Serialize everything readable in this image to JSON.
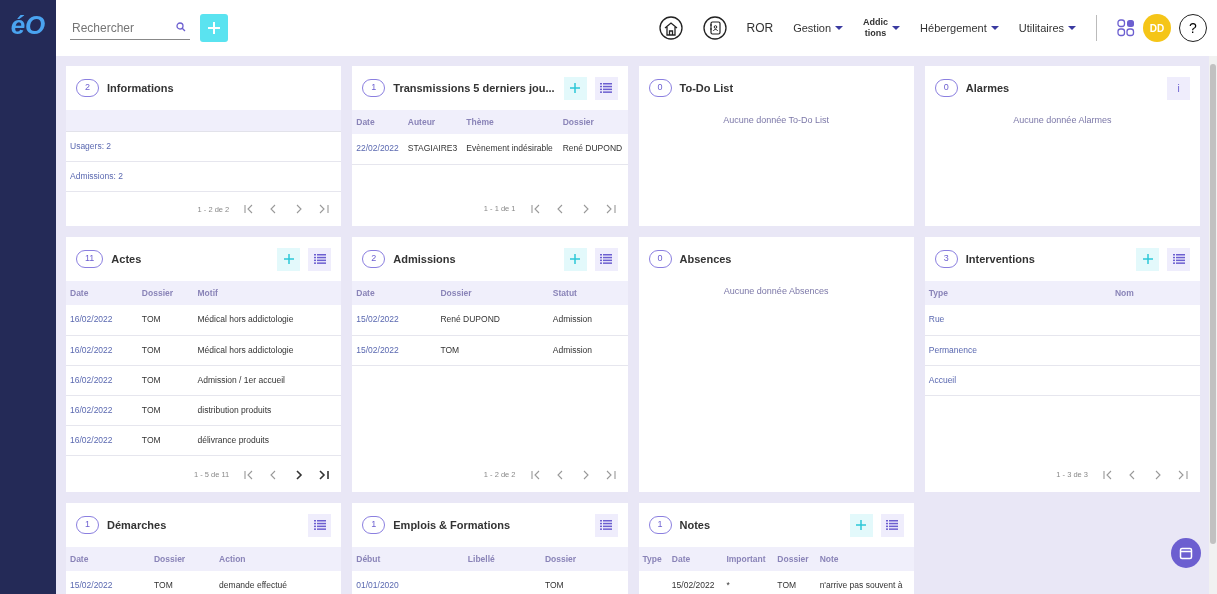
{
  "logo": {
    "text": "éO"
  },
  "search": {
    "placeholder": "Rechercher"
  },
  "topnav": [
    {
      "kind": "home"
    },
    {
      "kind": "contacts"
    },
    {
      "kind": "link",
      "label": "ROR"
    },
    {
      "kind": "dropdown",
      "label": "Gestion"
    },
    {
      "kind": "stacked",
      "lines": [
        "Addic",
        "tions"
      ]
    },
    {
      "kind": "dropdown",
      "label": "Hébergement"
    },
    {
      "kind": "dropdown",
      "label": "Utilitaires"
    }
  ],
  "user": {
    "initials": "DD",
    "help": "?"
  },
  "cards": [
    {
      "title": "Informations",
      "count": "2",
      "rows": [
        [
          "Usagers: 2"
        ],
        [
          "Admissions: 2"
        ]
      ],
      "pager": {
        "range": "1 - 2 de 2",
        "has_next": false
      }
    },
    {
      "title": "Transmissions 5 derniers jou...",
      "count": "1",
      "actions": [
        {
          "kind": "add"
        },
        {
          "kind": "list"
        }
      ],
      "columns": [
        "Date",
        "Auteur",
        "Thème",
        "Dossier"
      ],
      "rows": [
        [
          "22/02/2022",
          "STAGIAIRE3",
          "Evènement indésirable",
          "René DUPOND"
        ]
      ],
      "pager": {
        "range": "1 - 1 de 1",
        "has_next": false
      }
    },
    {
      "title": "To-Do List",
      "count": "0",
      "empty_text": "Aucune donnée To-Do List"
    },
    {
      "title": "Alarmes",
      "count": "0",
      "actions": [
        {
          "kind": "info",
          "label": "i"
        }
      ],
      "empty_text": "Aucune donnée Alarmes"
    },
    {
      "title": "Actes",
      "count": "11",
      "actions": [
        {
          "kind": "add"
        },
        {
          "kind": "list"
        }
      ],
      "columns": [
        "Date",
        "Dossier",
        "Motif"
      ],
      "rows": [
        [
          "16/02/2022",
          "TOM",
          "Médical hors addictologie"
        ],
        [
          "16/02/2022",
          "TOM",
          "Médical hors addictologie"
        ],
        [
          "16/02/2022",
          "TOM",
          "Admission / 1er accueil"
        ],
        [
          "16/02/2022",
          "TOM",
          "distribution produits"
        ],
        [
          "16/02/2022",
          "TOM",
          "délivrance produits"
        ]
      ],
      "pager": {
        "range": "1 - 5 de 11",
        "has_next": true
      }
    },
    {
      "title": "Admissions",
      "count": "2",
      "actions": [
        {
          "kind": "add"
        },
        {
          "kind": "list"
        }
      ],
      "columns": [
        "Date",
        "Dossier",
        "Statut"
      ],
      "rows": [
        [
          "15/02/2022",
          "René DUPOND",
          "Admission"
        ],
        [
          "15/02/2022",
          "TOM",
          "Admission"
        ]
      ],
      "pager": {
        "range": "1 - 2 de 2",
        "has_next": false
      }
    },
    {
      "title": "Absences",
      "count": "0",
      "empty_text": "Aucune donnée Absences"
    },
    {
      "title": "Interventions",
      "count": "3",
      "actions": [
        {
          "kind": "add"
        },
        {
          "kind": "list"
        }
      ],
      "columns": [
        "Type",
        "Nom"
      ],
      "rows": [
        [
          "Rue"
        ],
        [
          "Permanence"
        ],
        [
          "Accueil"
        ]
      ],
      "pager": {
        "range": "1 - 3 de 3",
        "has_next": false
      }
    },
    {
      "title": "Démarches",
      "count": "1",
      "actions": [
        {
          "kind": "list"
        }
      ],
      "columns": [
        "Date",
        "Dossier",
        "Action"
      ],
      "rows": [
        [
          "15/02/2022",
          "TOM",
          "demande effectué"
        ]
      ]
    },
    {
      "title": "Emplois & Formations",
      "count": "1",
      "actions": [
        {
          "kind": "list"
        }
      ],
      "columns": [
        "Début",
        "Libellé",
        "Dossier"
      ],
      "rows": [
        [
          "01/01/2020",
          "",
          "TOM"
        ]
      ]
    },
    {
      "title": "Notes",
      "count": "1",
      "actions": [
        {
          "kind": "add"
        },
        {
          "kind": "list"
        }
      ],
      "columns": [
        "Type",
        "Date",
        "Important",
        "Dossier",
        "Note"
      ],
      "rows": [
        [
          "",
          "15/02/2022",
          "*",
          "TOM",
          "n'arrive pas souvent à"
        ]
      ]
    }
  ]
}
